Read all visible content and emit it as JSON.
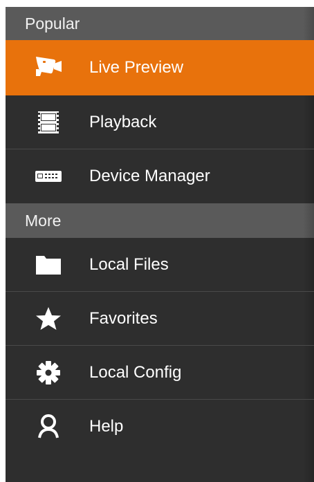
{
  "sections": [
    {
      "header": "Popular",
      "items": [
        {
          "label": "Live Preview",
          "icon": "camera-icon",
          "active": true
        },
        {
          "label": "Playback",
          "icon": "film-strip-icon"
        },
        {
          "label": "Device Manager",
          "icon": "dvr-device-icon"
        }
      ]
    },
    {
      "header": "More",
      "items": [
        {
          "label": "Local Files",
          "icon": "folder-icon"
        },
        {
          "label": "Favorites",
          "icon": "star-icon"
        },
        {
          "label": "Local Config",
          "icon": "gear-icon"
        },
        {
          "label": "Help",
          "icon": "person-icon"
        }
      ]
    }
  ],
  "colors": {
    "active_bg": "#e8720c",
    "panel_bg": "#2e2e2e",
    "header_bg": "#5a5a5a",
    "divider": "#4a4a4a"
  }
}
